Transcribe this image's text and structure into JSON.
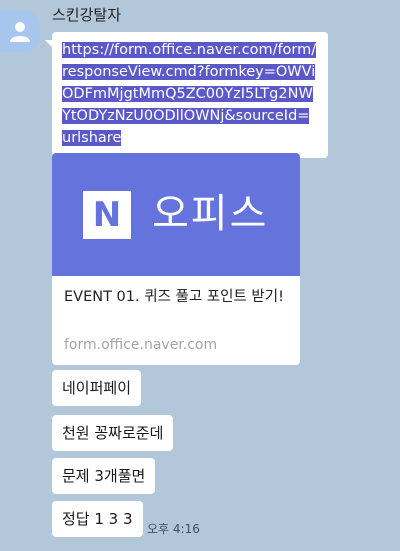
{
  "chat": {
    "sender_name": "스킨강탈자",
    "link_text": "https://form.office.naver.com/form/responseView.cmd?formkey=OWViODFmMjgtMmQ5ZC00YzI5LTg2NWYtODYzNzU0ODllOWNj&sourceId=urlshare",
    "card": {
      "logo_letter": "N",
      "banner_text": "오피스",
      "title": "EVENT 01. 퀴즈 풀고 포인트 받기!",
      "domain": "form.office.naver.com"
    },
    "messages": [
      "네이퍼페이",
      "천원 꽁짜로준데",
      "문제 3개풀면",
      "정답 1 3 3"
    ],
    "time": "오후 4:16"
  },
  "colors": {
    "background": "#b2c7d9",
    "selection": "#5b59c8",
    "card_banner": "#6574dd",
    "avatar": "#a7c6ee"
  },
  "icons": {
    "avatar": "default-profile-person-icon"
  }
}
